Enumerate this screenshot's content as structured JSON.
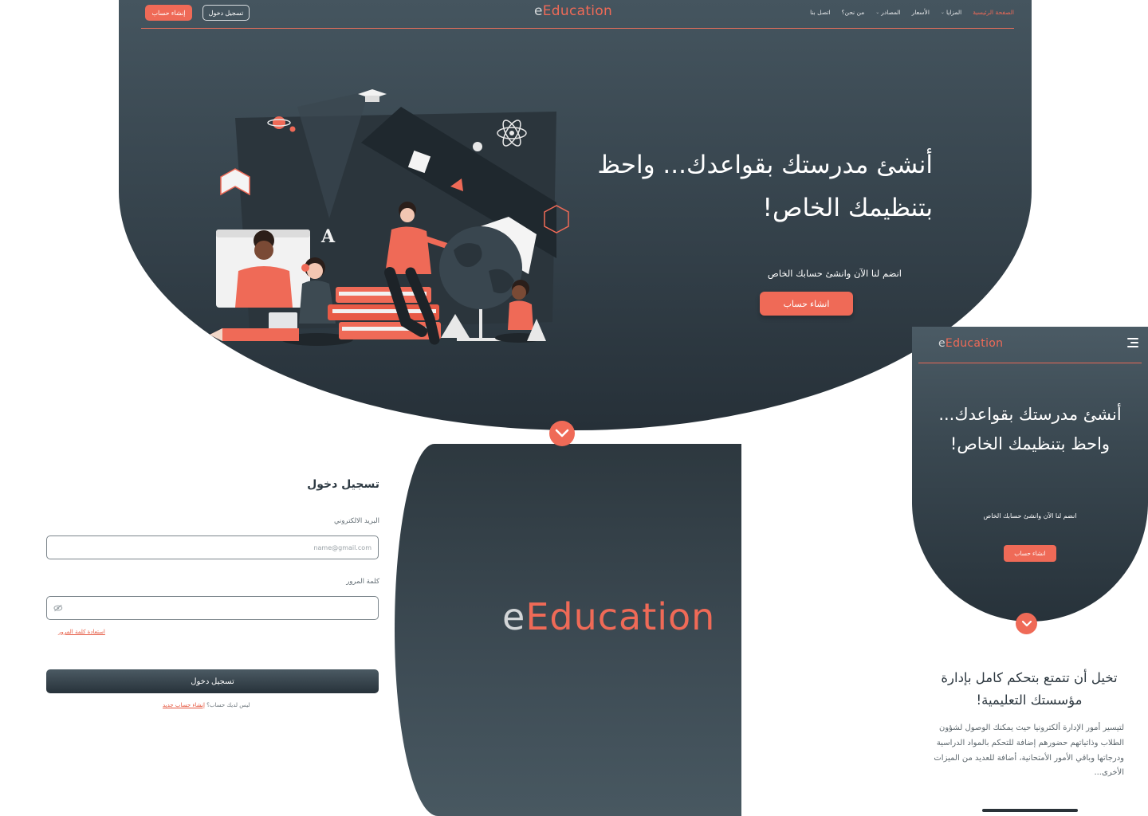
{
  "brand": {
    "logo_e": "e",
    "logo_rest": "Education"
  },
  "colors": {
    "accent": "#ef6a57",
    "dark": "#2d383f",
    "slate": "#45555f"
  },
  "nav": {
    "signup_label": "إنشاء حساب",
    "login_label": "تسجيل دخول",
    "items": [
      {
        "label": "الصفحة الرئيسية",
        "active": true
      },
      {
        "label": "المزايا",
        "dropdown": true
      },
      {
        "label": "الأسعار"
      },
      {
        "label": "المصادر",
        "dropdown": true
      },
      {
        "label": "من نحن؟"
      },
      {
        "label": "اتصل بنا"
      }
    ]
  },
  "hero": {
    "title": "أنشئ مدرستك بقواعدك... واحظ بتنظيمك الخاص!",
    "subtitle": "انضم لنا الآن وانشئ حسابك الخاص",
    "cta_label": "انشاء حساب",
    "scroll_icon": "chevron-down-icon"
  },
  "login": {
    "title": "تسجيل دخول",
    "email_label": "البريد الالكتروني",
    "email_placeholder": "name@gmail.com",
    "password_label": "كلمة المرور",
    "password_icon": "eye-off-icon",
    "forgot_label": "استعادة كلمة المرور",
    "submit_label": "تسجيل دخول",
    "no_account_text": "ليس لديك حساب؟",
    "new_account_link": "إنشاء حساب جديد"
  },
  "mobile": {
    "menu_icon": "hamburger-menu-icon",
    "title": "أنشئ مدرستك بقواعدك... واحظ بتنظيمك الخاص!",
    "subtitle": "انضم لنا الآن وانشئ حسابك الخاص",
    "cta_label": "انشاء حساب",
    "section_title": "تخيل أن تتمتع بتحكم كامل بإدارة مؤسستك التعليمية!",
    "section_text": "لتيسير أمور الإدارة ألكترونيا حيث يمكنك الوصول لشؤون الطلاب وذاتياتهم حضورهم إضافة للتحكم بالمواد الدراسية ودرجاتها وباقي الأمور الأمتحانية، أضافة للعديد من الميزات الأخرى..."
  }
}
